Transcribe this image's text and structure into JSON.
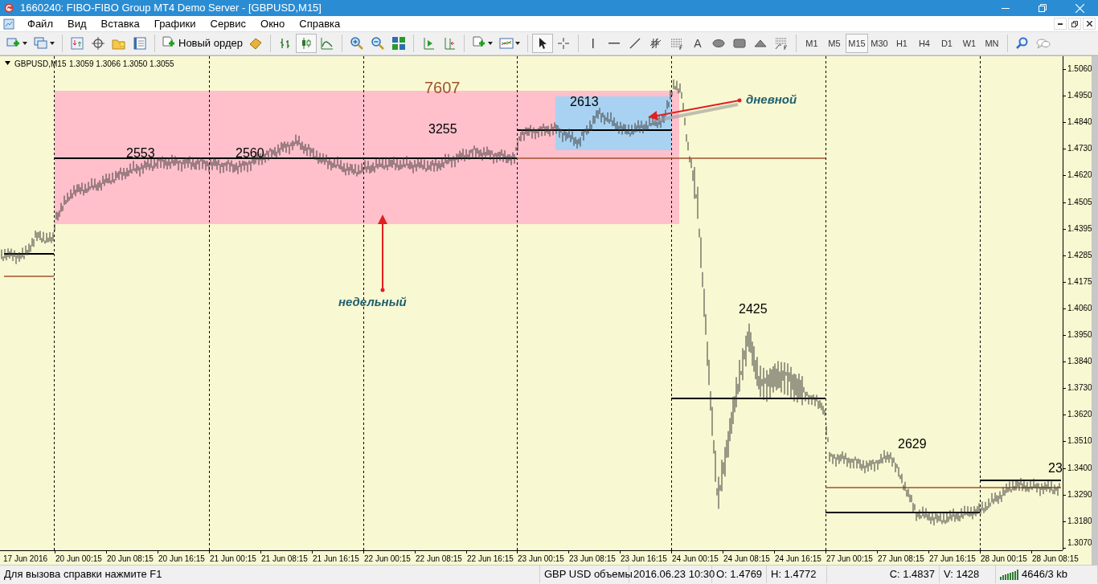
{
  "window": {
    "title": "1660240: FIBO-FIBO Group MT4 Demo Server - [GBPUSD,M15]"
  },
  "menu": [
    {
      "label": "Файл"
    },
    {
      "label": "Вид"
    },
    {
      "label": "Вставка"
    },
    {
      "label": "Графики"
    },
    {
      "label": "Сервис"
    },
    {
      "label": "Окно"
    },
    {
      "label": "Справка"
    }
  ],
  "toolbar": {
    "new_order": "Новый ордер",
    "text_tool": "A",
    "chart_modes": [
      {
        "selected": false
      },
      {
        "selected": true
      },
      {
        "selected": false
      }
    ],
    "pointer_tools": [
      {
        "selected": true
      },
      {
        "selected": false
      }
    ],
    "timeframes": [
      {
        "label": "M1",
        "selected": false
      },
      {
        "label": "M5",
        "selected": false
      },
      {
        "label": "M15",
        "selected": true
      },
      {
        "label": "M30",
        "selected": false
      },
      {
        "label": "H1",
        "selected": false
      },
      {
        "label": "H4",
        "selected": false
      },
      {
        "label": "D1",
        "selected": false
      },
      {
        "label": "W1",
        "selected": false
      },
      {
        "label": "MN",
        "selected": false
      }
    ]
  },
  "chart": {
    "symbol": "GBPUSD,M15",
    "quote": "1.3059 1.3066 1.3050 1.3055",
    "price_axis": [
      "1.5060",
      "1.4950",
      "1.4840",
      "1.4730",
      "1.4620",
      "1.4505",
      "1.4395",
      "1.4285",
      "1.4175",
      "1.4060",
      "1.3950",
      "1.3840",
      "1.3730",
      "1.3620",
      "1.3510",
      "1.3400",
      "1.3290",
      "1.3180",
      "1.3070"
    ],
    "time_axis": [
      "17 Jun 2016",
      "20 Jun 00:15",
      "20 Jun 08:15",
      "20 Jun 16:15",
      "21 Jun 00:15",
      "21 Jun 08:15",
      "21 Jun 16:15",
      "22 Jun 00:15",
      "22 Jun 08:15",
      "22 Jun 16:15",
      "23 Jun 00:15",
      "23 Jun 08:15",
      "23 Jun 16:15",
      "24 Jun 00:15",
      "24 Jun 08:15",
      "24 Jun 16:15",
      "27 Jun 00:15",
      "27 Jun 08:15",
      "27 Jun 16:15",
      "28 Jun 00:15",
      "28 Jun 08:15"
    ],
    "annotations": [
      {
        "text": "7607",
        "color": "#a0522d"
      },
      {
        "text": "3255",
        "color": "#000000"
      },
      {
        "text": "2553",
        "color": "#000000"
      },
      {
        "text": "2560",
        "color": "#000000"
      },
      {
        "text": "2613",
        "color": "#000000"
      },
      {
        "text": "2425",
        "color": "#000000"
      },
      {
        "text": "2629",
        "color": "#000000"
      },
      {
        "text": "23",
        "color": "#000000"
      }
    ],
    "labels": [
      {
        "text": "дневной"
      },
      {
        "text": "недельный"
      }
    ]
  },
  "status_bar": [
    "Для вызова справки нажмите F1",
    "GBP USD объемы",
    "2016.06.23 10:30",
    "O: 1.4769",
    "H: 1.4772",
    "C: 1.4837",
    "V: 1428",
    "4646/3 kb"
  ]
}
